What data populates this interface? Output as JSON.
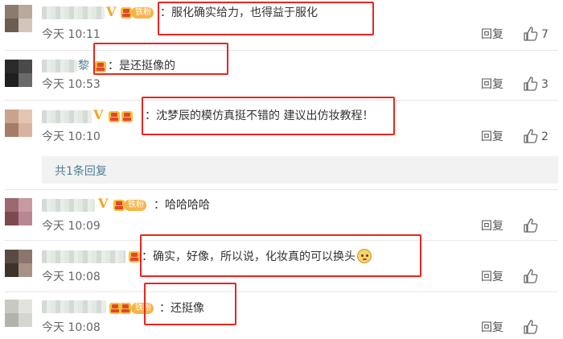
{
  "comments": [
    {
      "text": "：服化确实给力，也得益于服化",
      "time": "今天 10:11",
      "reply": "回复",
      "likes": "7",
      "badge": "铁粉",
      "badge_icon": "v-badge",
      "avatar_colors": [
        "#8a7b70",
        "#b8a99a",
        "#6b5d52",
        "#d2c6bb"
      ]
    },
    {
      "text": "：是还挺像的",
      "name_suffix": "黎",
      "time": "今天 10:53",
      "reply": "回复",
      "likes": "3",
      "avatar_colors": [
        "#2a2a2a",
        "#4a4a4a",
        "#1f1f1f",
        "#6a6a6a"
      ]
    },
    {
      "text": "：沈梦辰的模仿真挺不错的 建议出仿妆教程！",
      "time": "今天 10:10",
      "reply": "回复",
      "likes": "2",
      "badge_icon": "v-badge",
      "avatar_colors": [
        "#c9a38c",
        "#e4c5b2",
        "#a77c66",
        "#d8b49f"
      ]
    },
    {
      "text": "：哈哈哈哈",
      "time": "今天 10:09",
      "reply": "回复",
      "likes": "",
      "badge": "铁粉",
      "badge_icon": "v-badge",
      "avatar_colors": [
        "#9a6a70",
        "#c79aa0",
        "#7a4a50",
        "#b88690"
      ]
    },
    {
      "text": "：确实，好像，所以说，化妆真的可以换头",
      "time": "今天 10:08",
      "reply": "回复",
      "likes": "",
      "avatar_colors": [
        "#5a4a44",
        "#8b756c",
        "#3e322d",
        "#a99186"
      ]
    },
    {
      "text": "：还挺像",
      "time": "今天 10:08",
      "reply": "回复",
      "likes": "",
      "badge": "铁粉",
      "avatar_colors": [
        "#c9c9c3",
        "#e3e3dd",
        "#b3b3ad",
        "#d6d6d0"
      ]
    }
  ],
  "subreply": {
    "label": "共1条回复"
  },
  "colors": {
    "highlight": "#e8261f",
    "link": "#507d96",
    "badge": "#f6b44a",
    "v": "#f6a21e"
  }
}
